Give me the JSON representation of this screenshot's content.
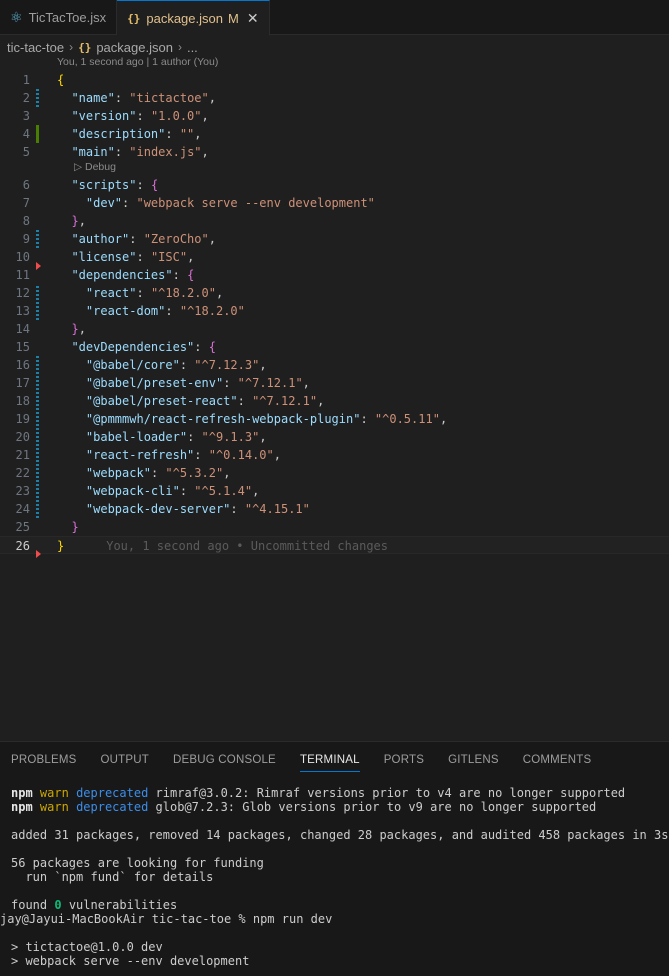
{
  "tabs": [
    {
      "label": "TicTacToe.jsx",
      "icon": "react-icon",
      "glyph": "⚛"
    },
    {
      "label": "package.json",
      "icon": "json-icon",
      "glyph": "{}",
      "modified": "M"
    }
  ],
  "breadcrumb": {
    "folder": "tic-tac-toe",
    "file": "package.json",
    "more": "..."
  },
  "editor": {
    "blame_header": "You, 1 second ago | 1 author (You)",
    "debug_lens": "Debug",
    "inline_blame": "You, 1 second ago • Uncommitted changes",
    "line_numbers": [
      "1",
      "2",
      "3",
      "4",
      "5",
      "6",
      "7",
      "8",
      "9",
      "10",
      "11",
      "12",
      "13",
      "14",
      "15",
      "16",
      "17",
      "18",
      "19",
      "20",
      "21",
      "22",
      "23",
      "24",
      "25",
      "26"
    ]
  },
  "panel": {
    "tabs": [
      "PROBLEMS",
      "OUTPUT",
      "DEBUG CONSOLE",
      "TERMINAL",
      "PORTS",
      "GITLENS",
      "COMMENTS"
    ],
    "active_tab": "TERMINAL",
    "terminal": {
      "warn1": {
        "npm": "npm",
        "warn": "warn",
        "dep": "deprecated",
        "msg": "rimraf@3.0.2: Rimraf versions prior to v4 are no longer supported"
      },
      "warn2": {
        "npm": "npm",
        "warn": "warn",
        "dep": "deprecated",
        "msg": "glob@7.2.3: Glob versions prior to v9 are no longer supported"
      },
      "added": "added 31 packages, removed 14 packages, changed 28 packages, and audited 458 packages in 3s",
      "funding1": "56 packages are looking for funding",
      "funding2": "  run `npm fund` for details",
      "found_pre": "found ",
      "found_num": "0",
      "found_post": " vulnerabilities",
      "prompt": "jay@Jayui-MacBookAir tic-tac-toe % npm run dev",
      "run1": "> tictactoe@1.0.0 dev",
      "run2": "> webpack serve --env development"
    }
  },
  "code": {
    "name": "\"tictactoe\"",
    "version": "\"1.0.0\"",
    "description": "\"\"",
    "main": "\"index.js\"",
    "dev": "\"webpack serve --env development\"",
    "author": "\"ZeroCho\"",
    "license": "\"ISC\"",
    "react": "\"^18.2.0\"",
    "react_dom": "\"^18.2.0\"",
    "babel_core": "\"^7.12.3\"",
    "babel_preset_env": "\"^7.12.1\"",
    "babel_preset_react": "\"^7.12.1\"",
    "refresh_plugin": "\"^0.5.11\"",
    "babel_loader": "\"^9.1.3\"",
    "react_refresh": "\"^0.14.0\"",
    "webpack": "\"^5.3.2\"",
    "webpack_cli": "\"^5.1.4\"",
    "webpack_dev_server": "\"^4.15.1\""
  }
}
